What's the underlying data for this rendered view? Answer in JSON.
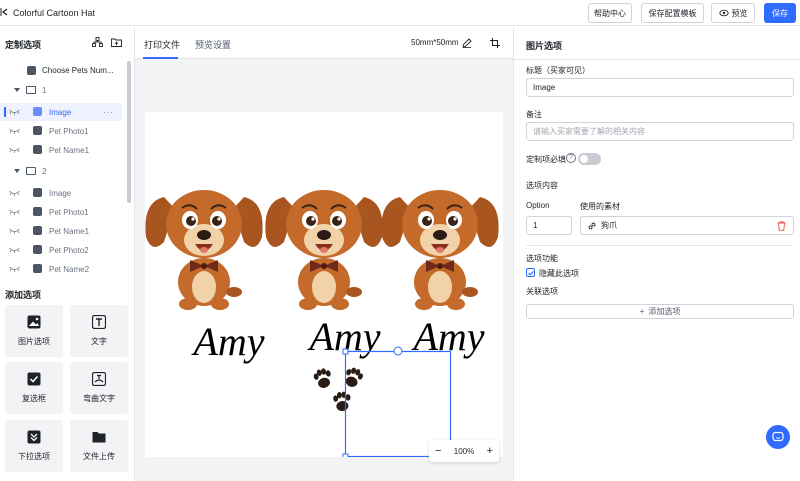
{
  "app": {
    "title": "Colorful Cartoon Hat"
  },
  "toolbar": {
    "help_label": "帮助中心",
    "save_template_label": "保存配置模板",
    "preview_label": "预览",
    "save_label": "保存"
  },
  "left_panel": {
    "title": "定制选项",
    "tree": [
      {
        "label": "Choose Pets Num..."
      },
      {
        "label": "1"
      },
      {
        "label": "Image",
        "more": "···"
      },
      {
        "label": "Pet Photo1"
      },
      {
        "label": "Pet Name1"
      },
      {
        "label": "2"
      },
      {
        "label": "Image"
      },
      {
        "label": "Pet Photo1"
      },
      {
        "label": "Pet Name1"
      },
      {
        "label": "Pet Photo2"
      },
      {
        "label": "Pet Name2"
      }
    ],
    "add_title": "添加选项",
    "tiles": [
      {
        "label": "图片选项",
        "icon": "image-icon"
      },
      {
        "label": "文字",
        "icon": "text-icon"
      },
      {
        "label": "复选框",
        "icon": "checkbox-icon"
      },
      {
        "label": "弯曲文字",
        "icon": "curved-text-icon"
      },
      {
        "label": "下拉选项",
        "icon": "dropdown-icon"
      },
      {
        "label": "文件上传",
        "icon": "folder-icon"
      }
    ]
  },
  "center": {
    "tab_print": "打印文件",
    "tab_preview": "预览设置",
    "size": "50mm*50mm",
    "names": [
      "Amy",
      "Amy",
      "Amy"
    ],
    "zoom": "100%"
  },
  "right_panel": {
    "title": "图片选项",
    "title_label": "标题（买家可见）",
    "title_value": "Image",
    "note_label": "备注",
    "note_placeholder": "请输入买家需要了解的相关内容",
    "required_label": "定制项必填",
    "content_label": "选项内容",
    "option_col": "Option",
    "material_col": "使用的素材",
    "option_value": "1",
    "material_value": "狗爪",
    "features_label": "选项功能",
    "hide_label": "隐藏此选项",
    "linked_label": "关联选项",
    "add_option_label": "添加选项"
  },
  "colors": {
    "accent": "#2f6bff",
    "dog_fur": "#c46a2b",
    "paw": "#2a1b14"
  }
}
